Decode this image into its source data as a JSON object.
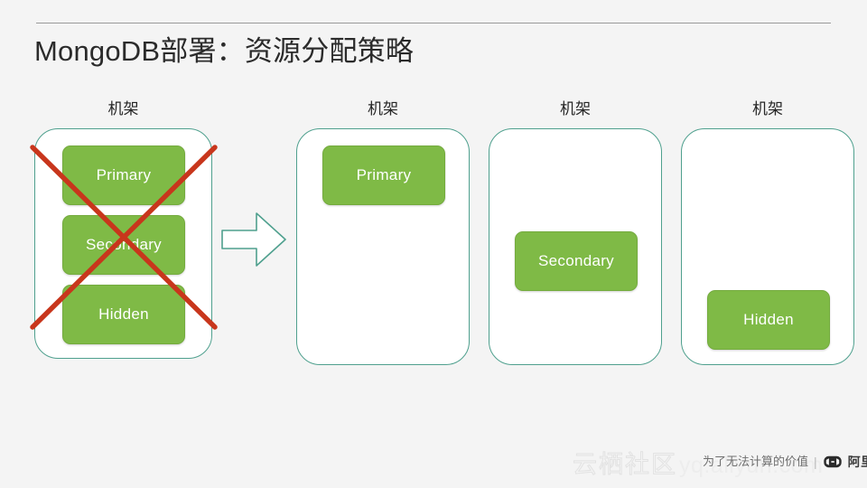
{
  "slide": {
    "title": "MongoDB部署：资源分配策略",
    "background_color": "#f4f4f4",
    "rule_color": "#9a9a9a"
  },
  "colors": {
    "node_green": "#7fba46",
    "rack_border_teal": "#4fa08e",
    "cross_red": "#c8361c",
    "arrow_outline": "#4fa08e"
  },
  "diagram": {
    "arrow": {
      "name": "transform-arrow",
      "direction": "right"
    },
    "cross": {
      "name": "invalid-marker",
      "meaning": "not-allowed"
    },
    "racks": [
      {
        "label": "机架",
        "invalid": true,
        "nodes": [
          {
            "label": "Primary",
            "slot": "top"
          },
          {
            "label": "Secondary",
            "slot": "middle"
          },
          {
            "label": "Hidden",
            "slot": "bottom"
          }
        ]
      },
      {
        "label": "机架",
        "invalid": false,
        "nodes": [
          {
            "label": "Primary",
            "slot": "top"
          }
        ]
      },
      {
        "label": "机架",
        "invalid": false,
        "nodes": [
          {
            "label": "Secondary",
            "slot": "middle"
          }
        ]
      },
      {
        "label": "机架",
        "invalid": false,
        "nodes": [
          {
            "label": "Hidden",
            "slot": "bottom"
          }
        ]
      }
    ]
  },
  "watermark": {
    "community": "云栖社区",
    "url": "yq.aliyun.com",
    "slogan": "为了无法计算的价值",
    "separator": "|",
    "brand": "阿里云",
    "bracket_left": "[",
    "bracket_right": "]"
  }
}
